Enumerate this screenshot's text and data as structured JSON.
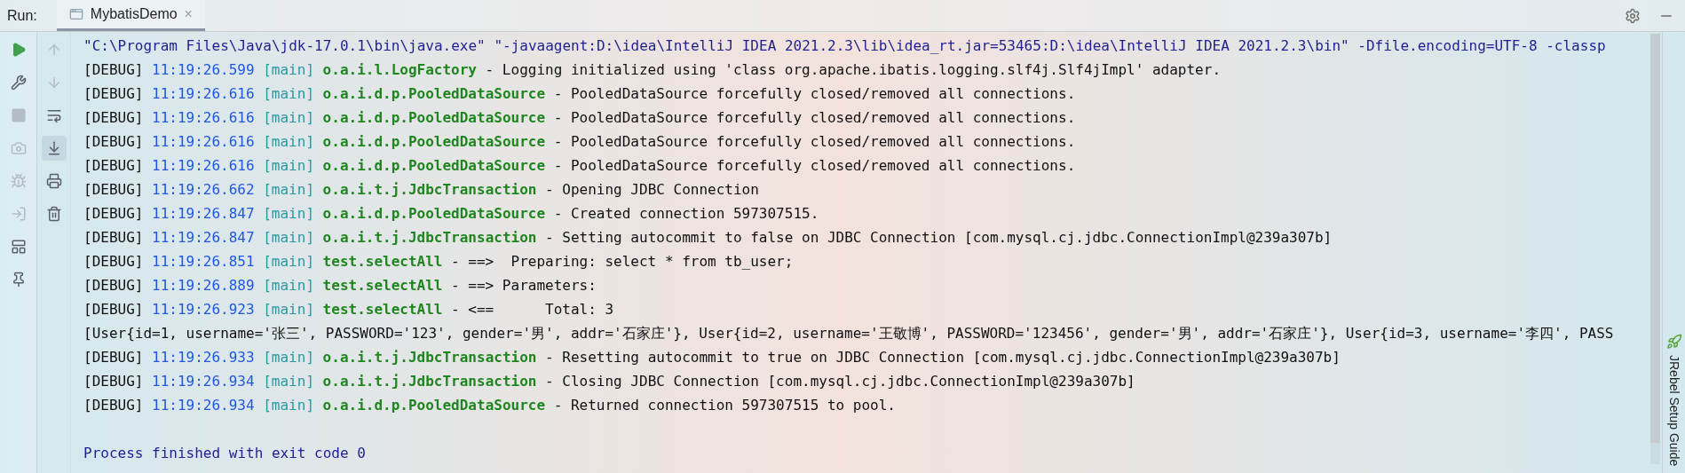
{
  "header": {
    "label": "Run:",
    "tabs": [
      {
        "label": "MybatisDemo",
        "selected": true,
        "close": "×"
      }
    ]
  },
  "toolbar_left": [
    {
      "kind": "run",
      "disabled": false
    },
    {
      "kind": "wrench",
      "disabled": false
    },
    {
      "kind": "stop",
      "disabled": true
    },
    {
      "kind": "camera",
      "disabled": true
    },
    {
      "kind": "bug",
      "disabled": true
    },
    {
      "kind": "login",
      "disabled": true
    },
    {
      "kind": "layout",
      "disabled": false
    },
    {
      "kind": "pin",
      "disabled": false
    }
  ],
  "toolbar_right": [
    {
      "kind": "up",
      "disabled": true,
      "selected": false
    },
    {
      "kind": "down",
      "disabled": true,
      "selected": false
    },
    {
      "kind": "wrap",
      "disabled": false,
      "selected": false
    },
    {
      "kind": "scroll-end",
      "disabled": false,
      "selected": true
    },
    {
      "kind": "print",
      "disabled": false,
      "selected": false
    },
    {
      "kind": "trash",
      "disabled": false,
      "selected": false
    }
  ],
  "console": {
    "command": "\"C:\\Program Files\\Java\\jdk-17.0.1\\bin\\java.exe\" \"-javaagent:D:\\idea\\IntelliJ IDEA 2021.2.3\\lib\\idea_rt.jar=53465:D:\\idea\\IntelliJ IDEA 2021.2.3\\bin\" -Dfile.encoding=UTF-8 -classp",
    "lines": [
      {
        "kind": "log",
        "level": "[DEBUG]",
        "time": "11:19:26.599",
        "thread": "[main]",
        "logger": "o.a.i.l.LogFactory",
        "message": "- Logging initialized using 'class org.apache.ibatis.logging.slf4j.Slf4jImpl' adapter."
      },
      {
        "kind": "log",
        "level": "[DEBUG]",
        "time": "11:19:26.616",
        "thread": "[main]",
        "logger": "o.a.i.d.p.PooledDataSource",
        "message": "- PooledDataSource forcefully closed/removed all connections."
      },
      {
        "kind": "log",
        "level": "[DEBUG]",
        "time": "11:19:26.616",
        "thread": "[main]",
        "logger": "o.a.i.d.p.PooledDataSource",
        "message": "- PooledDataSource forcefully closed/removed all connections."
      },
      {
        "kind": "log",
        "level": "[DEBUG]",
        "time": "11:19:26.616",
        "thread": "[main]",
        "logger": "o.a.i.d.p.PooledDataSource",
        "message": "- PooledDataSource forcefully closed/removed all connections."
      },
      {
        "kind": "log",
        "level": "[DEBUG]",
        "time": "11:19:26.616",
        "thread": "[main]",
        "logger": "o.a.i.d.p.PooledDataSource",
        "message": "- PooledDataSource forcefully closed/removed all connections."
      },
      {
        "kind": "log",
        "level": "[DEBUG]",
        "time": "11:19:26.662",
        "thread": "[main]",
        "logger": "o.a.i.t.j.JdbcTransaction",
        "message": "- Opening JDBC Connection"
      },
      {
        "kind": "log",
        "level": "[DEBUG]",
        "time": "11:19:26.847",
        "thread": "[main]",
        "logger": "o.a.i.d.p.PooledDataSource",
        "message": "- Created connection 597307515."
      },
      {
        "kind": "log",
        "level": "[DEBUG]",
        "time": "11:19:26.847",
        "thread": "[main]",
        "logger": "o.a.i.t.j.JdbcTransaction",
        "message": "- Setting autocommit to false on JDBC Connection [com.mysql.cj.jdbc.ConnectionImpl@239a307b]"
      },
      {
        "kind": "log",
        "level": "[DEBUG]",
        "time": "11:19:26.851",
        "thread": "[main]",
        "logger": "test.selectAll",
        "message": "- ==>  Preparing: select * from tb_user;"
      },
      {
        "kind": "log",
        "level": "[DEBUG]",
        "time": "11:19:26.889",
        "thread": "[main]",
        "logger": "test.selectAll",
        "message": "- ==> Parameters: "
      },
      {
        "kind": "log",
        "level": "[DEBUG]",
        "time": "11:19:26.923",
        "thread": "[main]",
        "logger": "test.selectAll",
        "message": "- <==      Total: 3"
      },
      {
        "kind": "output",
        "text": "[User{id=1, username='张三', PASSWORD='123', gender='男', addr='石家庄'}, User{id=2, username='王敬博', PASSWORD='123456', gender='男', addr='石家庄'}, User{id=3, username='李四', PASS"
      },
      {
        "kind": "log",
        "level": "[DEBUG]",
        "time": "11:19:26.933",
        "thread": "[main]",
        "logger": "o.a.i.t.j.JdbcTransaction",
        "message": "- Resetting autocommit to true on JDBC Connection [com.mysql.cj.jdbc.ConnectionImpl@239a307b]"
      },
      {
        "kind": "log",
        "level": "[DEBUG]",
        "time": "11:19:26.934",
        "thread": "[main]",
        "logger": "o.a.i.t.j.JdbcTransaction",
        "message": "- Closing JDBC Connection [com.mysql.cj.jdbc.ConnectionImpl@239a307b]"
      },
      {
        "kind": "log",
        "level": "[DEBUG]",
        "time": "11:19:26.934",
        "thread": "[main]",
        "logger": "o.a.i.d.p.PooledDataSource",
        "message": "- Returned connection 597307515 to pool."
      }
    ],
    "exit_message": "Process finished with exit code 0"
  },
  "side_panel": {
    "label": "JRebel Setup Guide"
  }
}
